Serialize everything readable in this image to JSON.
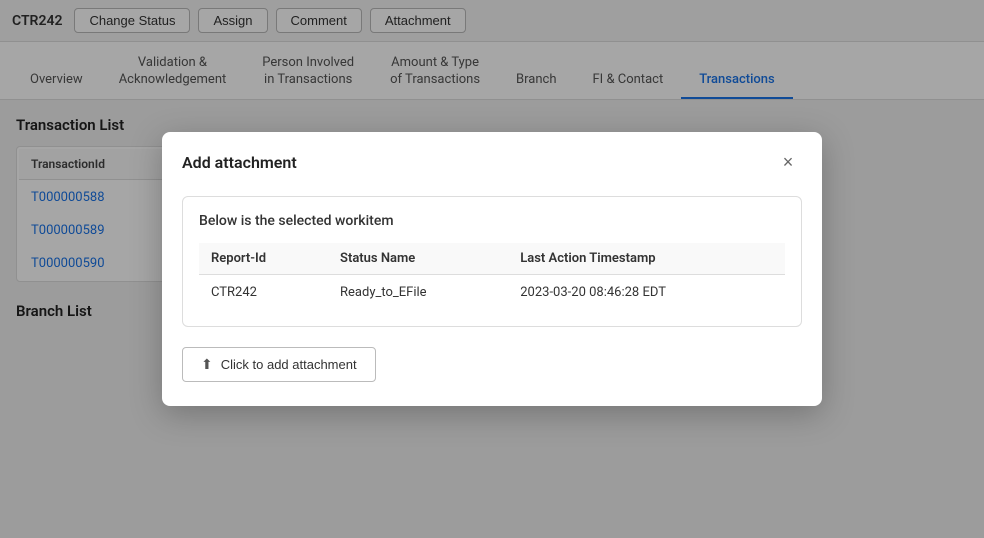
{
  "toolbar": {
    "id": "CTR242",
    "buttons": [
      {
        "label": "Change Status",
        "name": "change-status-button"
      },
      {
        "label": "Assign",
        "name": "assign-button"
      },
      {
        "label": "Comment",
        "name": "comment-button"
      },
      {
        "label": "Attachment",
        "name": "attachment-button"
      }
    ]
  },
  "nav": {
    "tabs": [
      {
        "label": "Overview",
        "name": "tab-overview",
        "active": false
      },
      {
        "label": "Validation &\nAcknowledgement",
        "name": "tab-validation",
        "active": false
      },
      {
        "label": "Person Involved\nin Transactions",
        "name": "tab-person",
        "active": false
      },
      {
        "label": "Amount & Type\nof Transactions",
        "name": "tab-amount",
        "active": false
      },
      {
        "label": "Branch",
        "name": "tab-branch",
        "active": false
      },
      {
        "label": "FI & Contact",
        "name": "tab-fi",
        "active": false
      },
      {
        "label": "Transactions",
        "name": "tab-transactions",
        "active": true
      }
    ]
  },
  "main": {
    "transaction_list_title": "Transaction List",
    "table": {
      "headers": [
        "TransactionId"
      ],
      "rows": [
        {
          "id": "T000000588"
        },
        {
          "id": "T000000589"
        },
        {
          "id": "T000000590"
        }
      ]
    },
    "branch_list_title": "Branch List"
  },
  "modal": {
    "title": "Add attachment",
    "close_label": "×",
    "workitem_label": "Below is the selected workitem",
    "table": {
      "headers": [
        "Report-Id",
        "Status Name",
        "Last Action Timestamp"
      ],
      "row": {
        "report_id": "CTR242",
        "status_name": "Ready_to_EFile",
        "timestamp": "2023-03-20 08:46:28 EDT"
      }
    },
    "attachment_btn_label": "Click to add attachment"
  }
}
